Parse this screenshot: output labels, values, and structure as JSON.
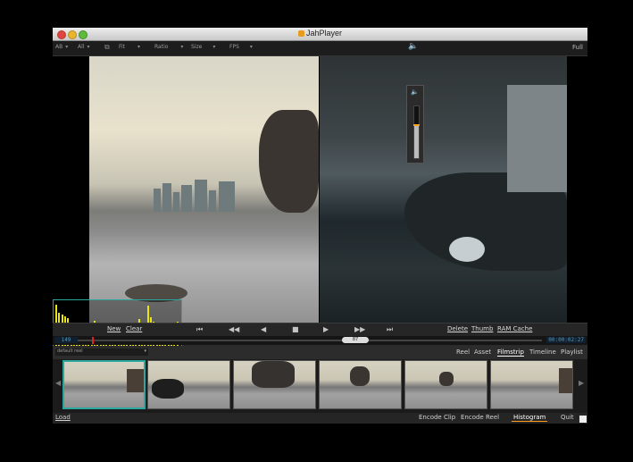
{
  "window": {
    "title": "JahPlayer"
  },
  "toolbar": {
    "items": [
      {
        "label": "AB",
        "name": "ab-select"
      },
      {
        "label": "All",
        "name": "all-select"
      },
      {
        "label": "Fit",
        "name": "fit-select"
      },
      {
        "label": "Ratio",
        "name": "ratio-select"
      },
      {
        "label": "Size",
        "name": "size-select"
      },
      {
        "label": "FPS",
        "name": "fps-select"
      }
    ],
    "full_label": "Full",
    "icons": [
      "compare-icon",
      "volume-icon"
    ]
  },
  "volume": {
    "level": 0.62
  },
  "controls": {
    "new_label": "New",
    "clear_label": "Clear",
    "delete_label": "Delete",
    "thumb_label": "Thumb",
    "ram_cache_label": "RAM Cache",
    "transport_icons": [
      "jump-start-icon",
      "step-back-icon",
      "play-reverse-icon",
      "stop-icon",
      "play-icon",
      "step-forward-icon",
      "jump-end-icon"
    ]
  },
  "timeline": {
    "start_frame": "149",
    "end_timecode": "00:00:02:27",
    "frame_pill": "87"
  },
  "panel": {
    "reel": "default reel",
    "tabs": [
      "Reel",
      "Asset",
      "Filmstrip",
      "Timeline",
      "Playlist"
    ],
    "active_tab": "Filmstrip"
  },
  "bottom": {
    "load_label": "Load",
    "encode_clip_label": "Encode Clip",
    "encode_reel_label": "Encode Reel",
    "histogram_label": "Histogram",
    "quit_label": "Quit"
  },
  "histogram": {
    "values": [
      0.95,
      0.78,
      0.74,
      0.7,
      0.66,
      0.58,
      0.5,
      0.45,
      0.38,
      0.3,
      0.25,
      0.22,
      0.48,
      0.62,
      0.55,
      0.3,
      0.2,
      0.26,
      0.3,
      0.33,
      0.28,
      0.36,
      0.3,
      0.25,
      0.4,
      0.58,
      0.48,
      0.35,
      0.65,
      0.56,
      0.45,
      0.92,
      0.68,
      0.6,
      0.52,
      0.48,
      0.4,
      0.3,
      0.25,
      0.45,
      0.56,
      0.6
    ]
  },
  "colors": {
    "accent": "#2aa8a0",
    "histogram": "#e9e412",
    "playhead": "#dd2222",
    "active_tab": "#ff9a1a"
  }
}
